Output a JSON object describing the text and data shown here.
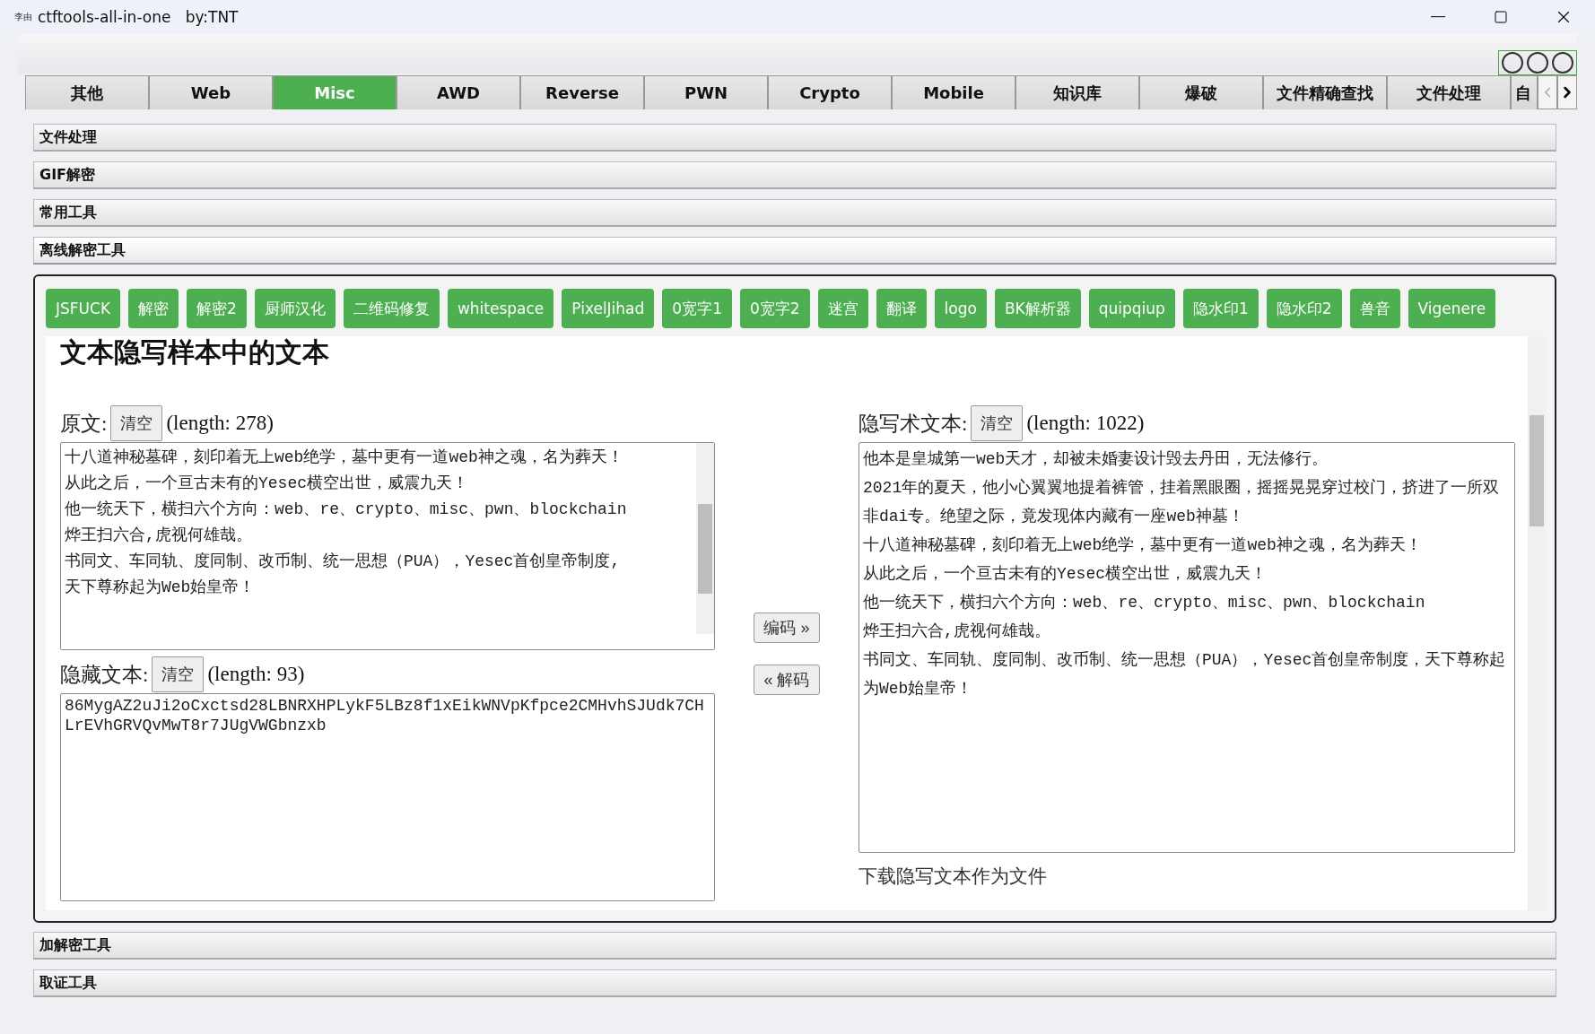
{
  "window": {
    "icon_text": "李由",
    "title": "ctftools-all-in-one   by:TNT"
  },
  "tabs": [
    {
      "label": "其他",
      "selected": false
    },
    {
      "label": "Web",
      "selected": false
    },
    {
      "label": "Misc",
      "selected": true
    },
    {
      "label": "AWD",
      "selected": false
    },
    {
      "label": "Reverse",
      "selected": false
    },
    {
      "label": "PWN",
      "selected": false
    },
    {
      "label": "Crypto",
      "selected": false
    },
    {
      "label": "Mobile",
      "selected": false
    },
    {
      "label": "知识库",
      "selected": false
    },
    {
      "label": "爆破",
      "selected": false
    },
    {
      "label": "文件精确查找",
      "selected": false
    },
    {
      "label": "文件处理",
      "selected": false
    },
    {
      "label": "自",
      "selected": false
    }
  ],
  "sections": [
    {
      "title": "文件处理",
      "expanded": false
    },
    {
      "title": "GIF解密",
      "expanded": false
    },
    {
      "title": "常用工具",
      "expanded": false
    },
    {
      "title": "离线解密工具",
      "expanded": true
    },
    {
      "title": "加解密工具",
      "expanded": false
    },
    {
      "title": "取证工具",
      "expanded": false
    }
  ],
  "tool_buttons": [
    "JSFUCK",
    "解密",
    "解密2",
    "厨师汉化",
    "二维码修复",
    "whitespace",
    "PixelJihad",
    "0宽字1",
    "0宽字2",
    "迷宫",
    "翻译",
    "logo",
    "BK解析器",
    "quipqiup",
    "隐水印1",
    "隐水印2",
    "兽音",
    "Vigenere"
  ],
  "tool": {
    "heading": "文本隐写样本中的文本",
    "original": {
      "label": "原文:",
      "clear": "清空",
      "length": "(length: 278)",
      "lines": [
        "十八道神秘墓碑，刻印着无上web绝学，墓中更有一道web神之魂，名为葬天！",
        "从此之后，一个亘古未有的Yesec横空出世，威震九天！",
        "他一统天下，横扫六个方向：web、re、crypto、misc、pwn、blockchain",
        "烨王扫六合,虎视何雄哉。",
        "书同文、车同轨、度同制、改币制、统一思想（PUA），Yesec首创皇帝制度,",
        "天下尊称起为Web始皇帝！"
      ]
    },
    "hidden": {
      "label": "隐藏文本:",
      "clear": "清空",
      "length": "(length: 93)",
      "lines": [
        "86MygAZ2uJi2oCxctsd28LBNRXHPLykF5LBz8f1xEikWNVpKfpce2CMHvhSJUdk7CHLrEVhGRVQvMwT8r7JUgVWGbnzxb"
      ]
    },
    "encode": "编码 »",
    "decode": "« 解码",
    "stego": {
      "label": "隐写术文本:",
      "clear": "清空",
      "length": "(length: 1022)",
      "lines": [
        "他本是皇城第一web天才，却被未婚妻设计毁去丹田，无法修行。",
        "2021年的夏天，他小心翼翼地提着裤管，挂着黑眼圈，摇摇晃晃穿过校门，挤进了一所双非dai专。绝望之际，竟发现体内藏有一座web神墓！",
        "十八道神秘墓碑，刻印着无上web绝学，墓中更有一道web神之魂，名为葬天！",
        "从此之后，一个亘古未有的Yesec横空出世，威震九天！",
        "他一统天下，横扫六个方向：web、re、crypto、misc、pwn、blockchain",
        "烨王扫六合,虎视何雄哉。",
        "书同文、车同轨、度同制、改币制、统一思想（PUA），Yesec首创皇帝制度，天下尊称起为Web始皇帝！"
      ]
    },
    "download": "下载隐写文本作为文件"
  }
}
